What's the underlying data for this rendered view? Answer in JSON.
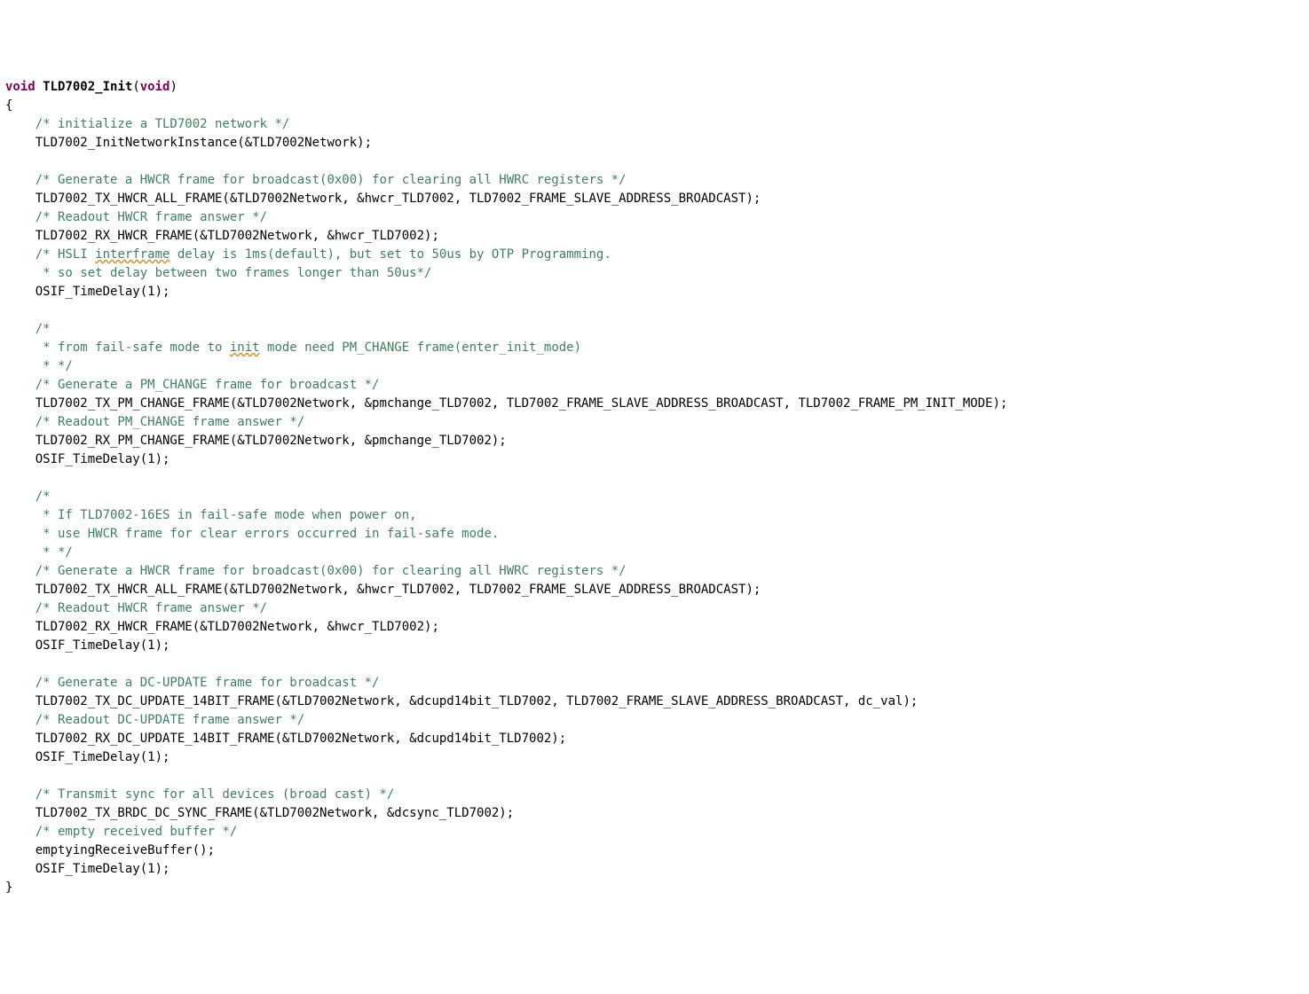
{
  "sig": {
    "kw": "void",
    "name": "TLD7002_Init",
    "params": "void"
  },
  "lines": [
    {
      "cls": "code",
      "txt": "{"
    },
    {
      "cls": "cmt",
      "ind": 1,
      "txt": "/* initialize a TLD7002 network */"
    },
    {
      "cls": "code",
      "ind": 1,
      "txt": "TLD7002_InitNetworkInstance(&TLD7002Network);"
    },
    {
      "cls": "blank"
    },
    {
      "cls": "cmt",
      "ind": 1,
      "txt": "/* Generate a HWCR frame for broadcast(0x00) for clearing all HWRC registers */"
    },
    {
      "cls": "code",
      "ind": 1,
      "txt": "TLD7002_TX_HWCR_ALL_FRAME(&TLD7002Network, &hwcr_TLD7002, TLD7002_FRAME_SLAVE_ADDRESS_BROADCAST);"
    },
    {
      "cls": "cmt",
      "ind": 1,
      "txt": "/* Readout HWCR frame answer */"
    },
    {
      "cls": "code",
      "ind": 1,
      "txt": "TLD7002_RX_HWCR_FRAME(&TLD7002Network, &hwcr_TLD7002);"
    },
    {
      "cls": "cmt",
      "ind": 1,
      "segs": [
        {
          "t": "/* HSLI "
        },
        {
          "t": "interframe",
          "squig": true
        },
        {
          "t": " delay is 1ms(default), but set to 50us by OTP Programming."
        }
      ]
    },
    {
      "cls": "cmt",
      "ind": 1,
      "txt": " * so set delay between two frames longer than 50us*/"
    },
    {
      "cls": "code",
      "ind": 1,
      "txt": "OSIF_TimeDelay(1);"
    },
    {
      "cls": "blank"
    },
    {
      "cls": "cmt",
      "ind": 1,
      "txt": "/*"
    },
    {
      "cls": "cmt",
      "ind": 1,
      "segs": [
        {
          "t": " * from fail-safe mode to "
        },
        {
          "t": "init",
          "squig": true
        },
        {
          "t": " mode need PM_CHANGE frame(enter_init_mode)"
        }
      ]
    },
    {
      "cls": "cmt",
      "ind": 1,
      "txt": " * */"
    },
    {
      "cls": "cmt",
      "ind": 1,
      "txt": "/* Generate a PM_CHANGE frame for broadcast */"
    },
    {
      "cls": "code",
      "ind": 1,
      "txt": "TLD7002_TX_PM_CHANGE_FRAME(&TLD7002Network, &pmchange_TLD7002, TLD7002_FRAME_SLAVE_ADDRESS_BROADCAST, TLD7002_FRAME_PM_INIT_MODE);"
    },
    {
      "cls": "cmt",
      "ind": 1,
      "txt": "/* Readout PM_CHANGE frame answer */"
    },
    {
      "cls": "code",
      "ind": 1,
      "txt": "TLD7002_RX_PM_CHANGE_FRAME(&TLD7002Network, &pmchange_TLD7002);"
    },
    {
      "cls": "code",
      "ind": 1,
      "txt": "OSIF_TimeDelay(1);"
    },
    {
      "cls": "blank"
    },
    {
      "cls": "cmt",
      "ind": 1,
      "txt": "/*"
    },
    {
      "cls": "cmt",
      "ind": 1,
      "txt": " * If TLD7002-16ES in fail-safe mode when power on,"
    },
    {
      "cls": "cmt",
      "ind": 1,
      "txt": " * use HWCR frame for clear errors occurred in fail-safe mode."
    },
    {
      "cls": "cmt",
      "ind": 1,
      "txt": " * */"
    },
    {
      "cls": "cmt",
      "ind": 1,
      "txt": "/* Generate a HWCR frame for broadcast(0x00) for clearing all HWRC registers */"
    },
    {
      "cls": "code",
      "ind": 1,
      "txt": "TLD7002_TX_HWCR_ALL_FRAME(&TLD7002Network, &hwcr_TLD7002, TLD7002_FRAME_SLAVE_ADDRESS_BROADCAST);"
    },
    {
      "cls": "cmt",
      "ind": 1,
      "txt": "/* Readout HWCR frame answer */"
    },
    {
      "cls": "code",
      "ind": 1,
      "txt": "TLD7002_RX_HWCR_FRAME(&TLD7002Network, &hwcr_TLD7002);"
    },
    {
      "cls": "code",
      "ind": 1,
      "txt": "OSIF_TimeDelay(1);"
    },
    {
      "cls": "blank"
    },
    {
      "cls": "cmt",
      "ind": 1,
      "txt": "/* Generate a DC-UPDATE frame for broadcast */"
    },
    {
      "cls": "code",
      "ind": 1,
      "txt": "TLD7002_TX_DC_UPDATE_14BIT_FRAME(&TLD7002Network, &dcupd14bit_TLD7002, TLD7002_FRAME_SLAVE_ADDRESS_BROADCAST, dc_val);"
    },
    {
      "cls": "cmt",
      "ind": 1,
      "txt": "/* Readout DC-UPDATE frame answer */"
    },
    {
      "cls": "code",
      "ind": 1,
      "txt": "TLD7002_RX_DC_UPDATE_14BIT_FRAME(&TLD7002Network, &dcupd14bit_TLD7002);"
    },
    {
      "cls": "code",
      "ind": 1,
      "txt": "OSIF_TimeDelay(1);"
    },
    {
      "cls": "blank"
    },
    {
      "cls": "cmt",
      "ind": 1,
      "txt": "/* Transmit sync for all devices (broad cast) */"
    },
    {
      "cls": "code",
      "ind": 1,
      "txt": "TLD7002_TX_BRDC_DC_SYNC_FRAME(&TLD7002Network, &dcsync_TLD7002);"
    },
    {
      "cls": "cmt",
      "ind": 1,
      "txt": "/* empty received buffer */"
    },
    {
      "cls": "code",
      "ind": 1,
      "txt": "emptyingReceiveBuffer();"
    },
    {
      "cls": "code",
      "ind": 1,
      "txt": "OSIF_TimeDelay(1);"
    },
    {
      "cls": "code",
      "txt": "}"
    }
  ]
}
